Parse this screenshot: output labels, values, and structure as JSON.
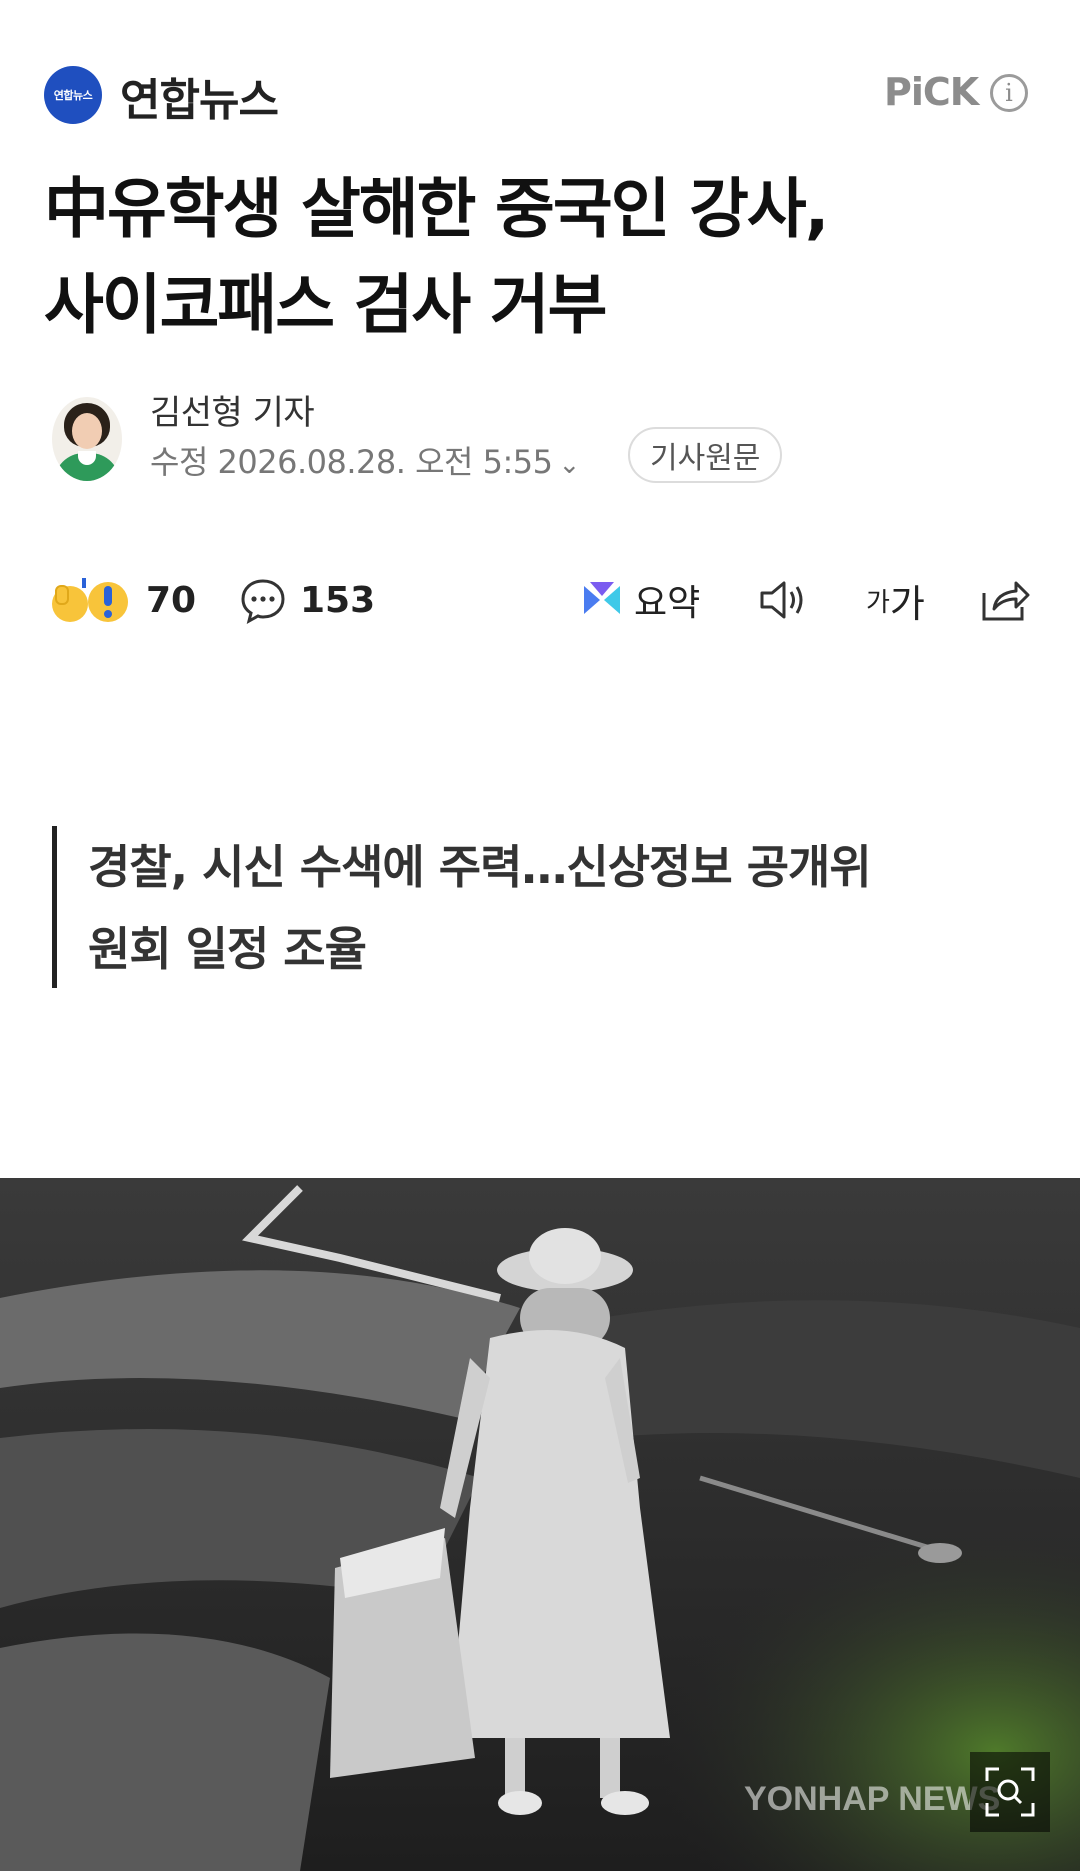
{
  "header": {
    "press_logo_text": "연합뉴스",
    "press_name": "연합뉴스",
    "pick_label": "PiCK",
    "info_icon": "i"
  },
  "article": {
    "title_line1": "中유학생 살해한 중국인 강사,",
    "title_line2": "사이코패스 검사 거부",
    "reporter": "김선형 기자",
    "date": "수정 2026.08.28. 오전 5:55",
    "original_button": "기사원문",
    "summary_line1": "경찰, 시신 수색에 주력…신상정보 공개위",
    "summary_line2": "원회 일정 조율"
  },
  "actions": {
    "reaction_count": "70",
    "comment_count": "153",
    "summary_label": "요약",
    "font_small": "가",
    "font_large": "가"
  },
  "photo": {
    "watermark": "YONHAP NEWS"
  },
  "colors": {
    "brand": "#1f4fbf",
    "pick": "#8c8c8c"
  }
}
